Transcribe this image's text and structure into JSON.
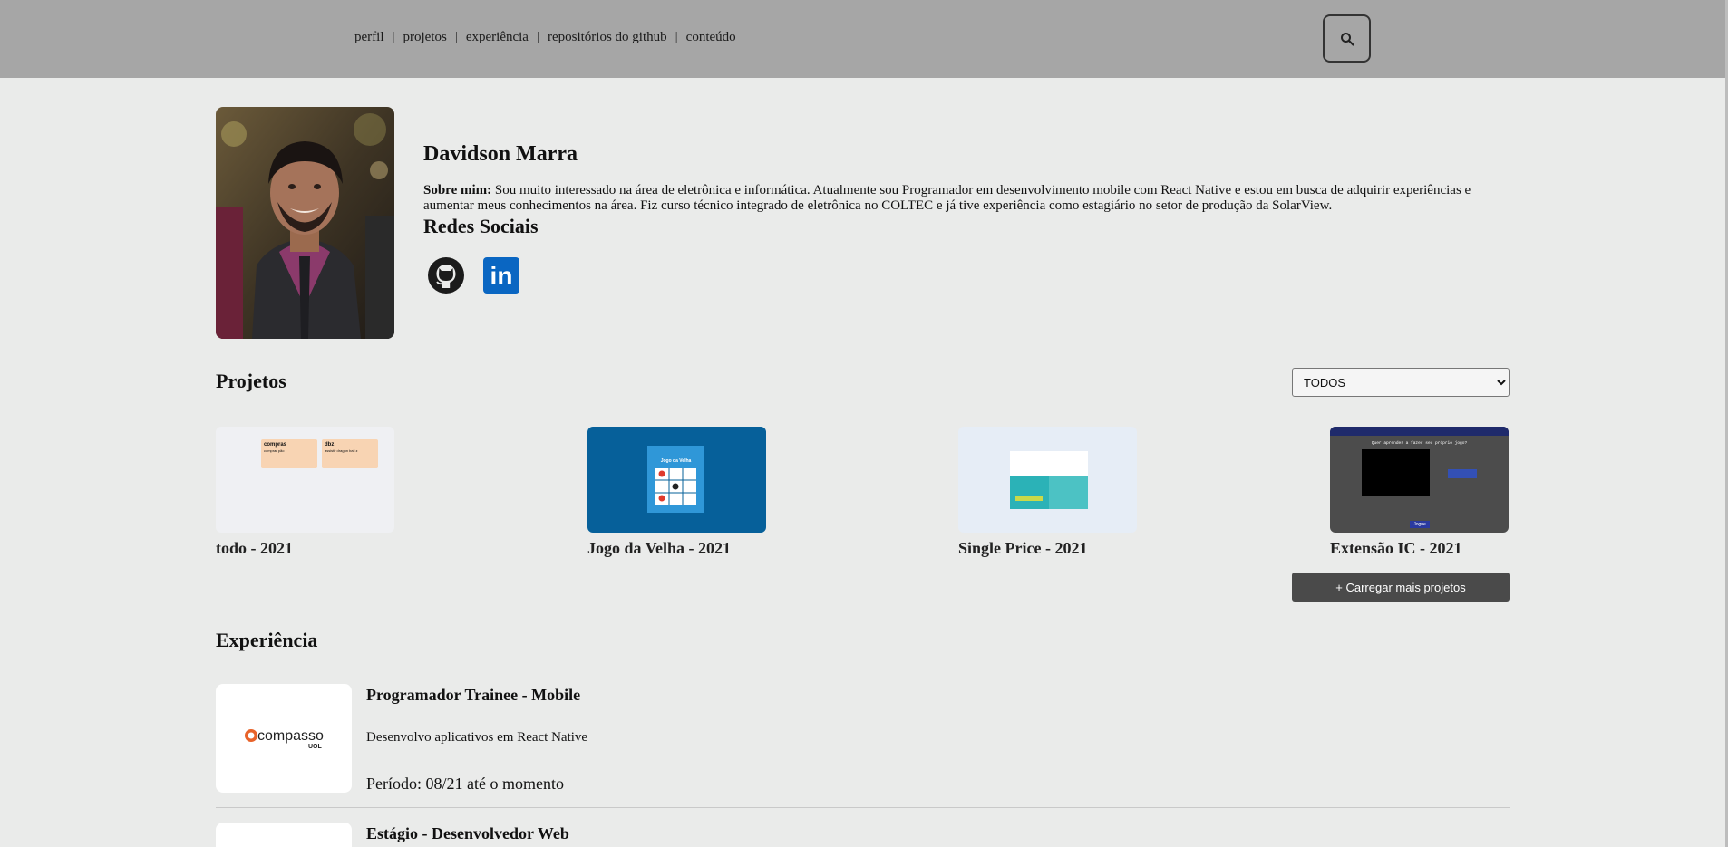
{
  "nav": {
    "items": [
      "perfil",
      "projetos",
      "experiência",
      "repositórios do github",
      "conteúdo"
    ],
    "separator": "|"
  },
  "search": {
    "icon": "search-icon"
  },
  "profile": {
    "name": "Davidson Marra",
    "about_label": "Sobre mim:",
    "about_text": " Sou muito interessado na área de eletrônica e informática. Atualmente sou Programador em desenvolvimento mobile com React Native e estou em busca de adquirir experiências e aumentar meus conhecimentos na área. Fiz curso técnico integrado de eletrônica no COLTEC e já tive experiência como estagiário no setor de produção da SolarView.",
    "social_title": "Redes Sociais",
    "social": [
      {
        "name": "github",
        "icon": "github-icon"
      },
      {
        "name": "linkedin",
        "icon": "linkedin-icon",
        "text": "in"
      }
    ]
  },
  "projects": {
    "title": "Projetos",
    "filter": {
      "selected": "TODOS"
    },
    "items": [
      {
        "caption": "todo - 2021",
        "thumb_text": [
          "compras",
          "comprar pão",
          "dbz",
          "assistir dragon ball z"
        ]
      },
      {
        "caption": "Jogo da Velha - 2021",
        "thumb_text": [
          "Jogo da Velha"
        ]
      },
      {
        "caption": "Single Price - 2021"
      },
      {
        "caption": "Extensão IC - 2021",
        "thumb_text": [
          "Quer aprender a fazer seu próprio jogo?",
          "Jogue"
        ]
      }
    ],
    "load_more": "+ Carregar mais projetos"
  },
  "experience": {
    "title": "Experiência",
    "items": [
      {
        "role": "Programador Trainee - Mobile",
        "description": "Desenvolvo aplicativos em React Native",
        "period": "Período: 08/21 até o momento",
        "logo_text": "compasso",
        "logo_sub": "UOL"
      },
      {
        "role": "Estágio - Desenvolvedor Web"
      }
    ]
  },
  "colors": {
    "topbar": "#a6a6a6",
    "background": "#eaebea",
    "button_dark": "#4a4a4a",
    "linkedin": "#0a66c2",
    "jogo_bg": "#06609a",
    "compasso_orange": "#e8632a"
  }
}
